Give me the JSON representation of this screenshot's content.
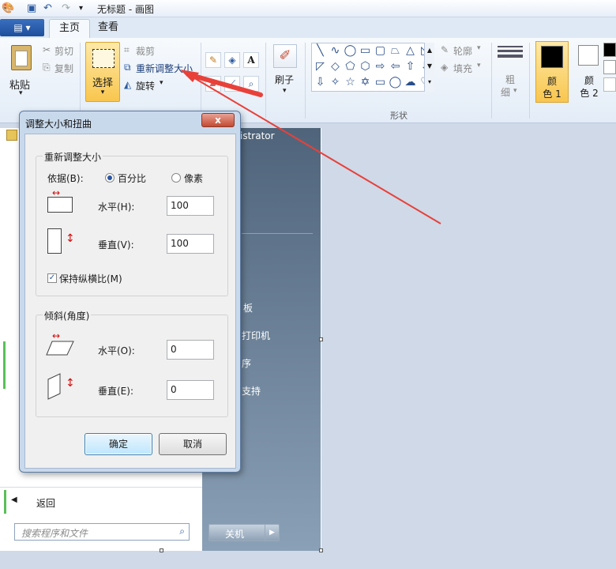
{
  "window": {
    "title": "无标题 - 画图"
  },
  "tabs": {
    "file": "▤ ▾",
    "home": "主页",
    "view": "查看"
  },
  "ribbon": {
    "paste": "粘贴",
    "cut": "剪切",
    "copy": "复制",
    "select": "选择",
    "crop": "裁剪",
    "resize": "重新调整大小",
    "rotate": "旋转",
    "brush": "刷子",
    "outline": "轮廓",
    "fill": "填充",
    "shapes_label": "形状",
    "size_line1": "粗",
    "size_line2": "细",
    "color1_line1": "颜",
    "color1_line2": "色 1",
    "color2_line1": "颜",
    "color2_line2": "色 2"
  },
  "startmenu": {
    "user": "istrator",
    "item1": "板",
    "item2": "打印机",
    "item3": "序",
    "item4": "支持",
    "back": "返回",
    "search_placeholder": "搜索程序和文件",
    "shutdown": "关机"
  },
  "dialog": {
    "title": "调整大小和扭曲",
    "close": "x",
    "resize_group": "重新调整大小",
    "basis_label": "依据(B):",
    "percent": "百分比",
    "pixels": "像素",
    "horizontal_label": "水平(H):",
    "horizontal_value": "100",
    "vertical_label": "垂直(V):",
    "vertical_value": "100",
    "keep_ratio": "保持纵横比(M)",
    "skew_group": "倾斜(角度)",
    "skew_h_label": "水平(O):",
    "skew_h_value": "0",
    "skew_v_label": "垂直(E):",
    "skew_v_value": "0",
    "ok": "确定",
    "cancel": "取消"
  },
  "colors": {
    "annotation_arrow": "#e8413a",
    "accent": "#f9c64e"
  }
}
